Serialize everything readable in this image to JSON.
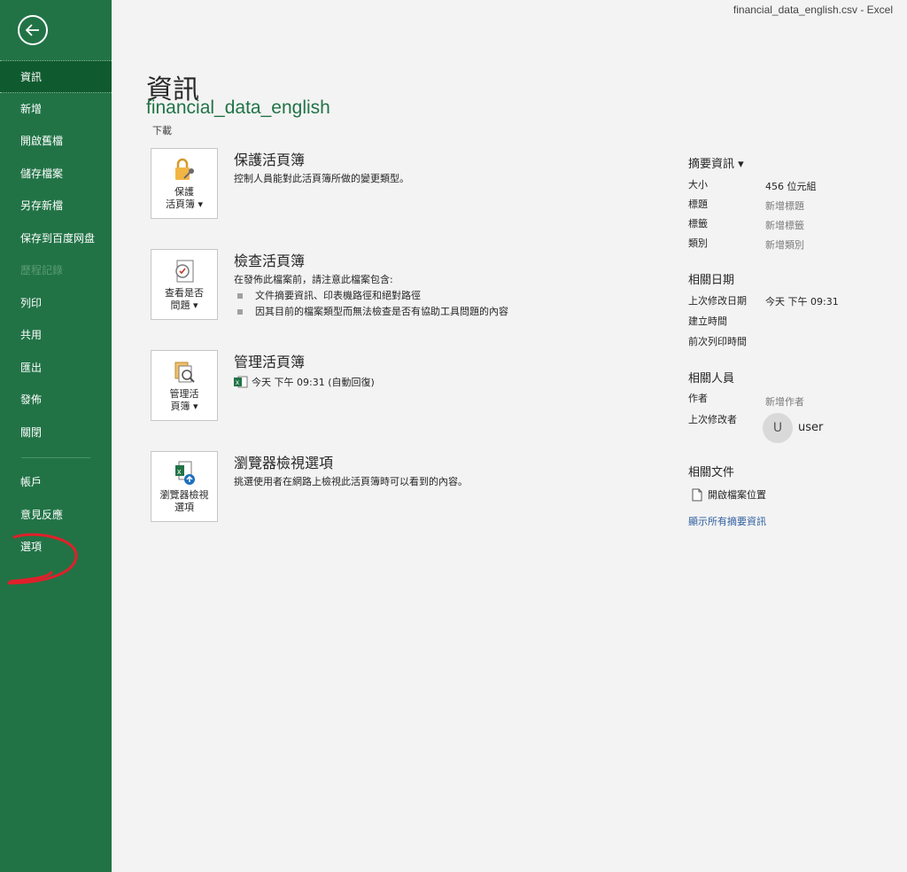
{
  "titlebar": {
    "text": "financial_data_english.csv  -  Excel"
  },
  "sidebar": {
    "items": [
      {
        "label": "資訊"
      },
      {
        "label": "新增"
      },
      {
        "label": "開啟舊檔"
      },
      {
        "label": "儲存檔案"
      },
      {
        "label": "另存新檔"
      },
      {
        "label": "保存到百度网盘"
      },
      {
        "label": "歷程記錄"
      },
      {
        "label": "列印"
      },
      {
        "label": "共用"
      },
      {
        "label": "匯出"
      },
      {
        "label": "發佈"
      },
      {
        "label": "關閉"
      }
    ],
    "bottom_items": [
      {
        "label": "帳戶"
      },
      {
        "label": "意見反應"
      },
      {
        "label": "選項"
      }
    ]
  },
  "main": {
    "title": "資訊",
    "doc_name": "financial_data_english",
    "doc_sub": "下載",
    "sections": {
      "protect": {
        "tile_line1": "保護",
        "tile_line2": "活頁簿 ▾",
        "title": "保護活頁簿",
        "desc": "控制人員能對此活頁簿所做的變更類型。"
      },
      "inspect": {
        "tile_line1": "查看是否",
        "tile_line2": "問題 ▾",
        "title": "檢查活頁簿",
        "desc": "在發佈此檔案前，請注意此檔案包含:",
        "bullets": [
          "文件摘要資訊、印表機路徑和絕對路徑",
          "因其目前的檔案類型而無法檢查是否有協助工具問題的內容"
        ]
      },
      "manage": {
        "tile_line1": "管理活",
        "tile_line2": "頁簿 ▾",
        "title": "管理活頁簿",
        "version": "今天 下午 09:31 (自動回復)"
      },
      "browser": {
        "tile_line1": "瀏覽器檢視",
        "tile_line2": "選項",
        "title": "瀏覽器檢視選項",
        "desc": "挑選使用者在網路上檢視此活頁簿時可以看到的內容。"
      }
    }
  },
  "properties": {
    "header": "摘要資訊 ▾",
    "rows": [
      {
        "label": "大小",
        "value": "456 位元組"
      },
      {
        "label": "標題",
        "value": "新增標題"
      },
      {
        "label": "標籤",
        "value": "新增標籤"
      },
      {
        "label": "類別",
        "value": "新增類別"
      }
    ],
    "dates_header": "相關日期",
    "dates": [
      {
        "label": "上次修改日期",
        "value": "今天 下午 09:31"
      },
      {
        "label": "建立時間",
        "value": ""
      },
      {
        "label": "前次列印時間",
        "value": ""
      }
    ],
    "people_header": "相關人員",
    "author_label": "作者",
    "author_value": "新增作者",
    "modified_by_label": "上次修改者",
    "avatar_initial": "U",
    "user_name": "user",
    "docs_header": "相關文件",
    "open_location": "開啟檔案位置",
    "show_all": "顯示所有摘要資訊"
  },
  "colors": {
    "sidebar": "#217346",
    "active": "#0f5a2e",
    "accent": "#217346",
    "link": "#2e5f9e",
    "annotation": "#e0202a"
  }
}
